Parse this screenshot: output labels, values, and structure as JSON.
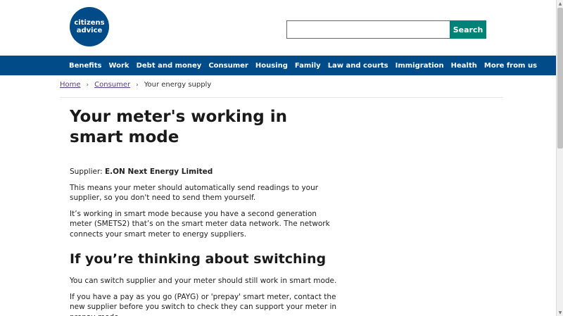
{
  "header": {
    "logo_line1": "citizens",
    "logo_line2": "advice",
    "search_placeholder": "",
    "search_value": "",
    "search_button": "Search"
  },
  "nav": {
    "items": [
      "Benefits",
      "Work",
      "Debt and money",
      "Consumer",
      "Housing",
      "Family",
      "Law and courts",
      "Immigration",
      "Health",
      "More from us"
    ]
  },
  "breadcrumb": {
    "home": "Home",
    "consumer": "Consumer",
    "current": "Your energy supply",
    "separator": "›"
  },
  "main": {
    "title": "Your meter's working in smart mode",
    "supplier_label": "Supplier: ",
    "supplier_name": "E.ON Next Energy Limited",
    "para1": "This means your meter should automatically send readings to your supplier, so you don't need to send them yourself.",
    "para2": "It’s working in smart mode because you have a second generation meter (SMETS2) that’s on the smart meter data network. The network connects your smart meter to energy suppliers.",
    "section_title": "If you’re thinking about switching",
    "para3": "You can switch supplier and your meter should still work in smart mode.",
    "para4": "If you have a pay as you go (PAYG) or 'prepay' smart meter, contact the new supplier before you switch to check they can support your meter in prepay mode."
  },
  "colors": {
    "brand_blue": "#004b88",
    "search_green": "#008276",
    "link_purple": "#5a3c84"
  }
}
